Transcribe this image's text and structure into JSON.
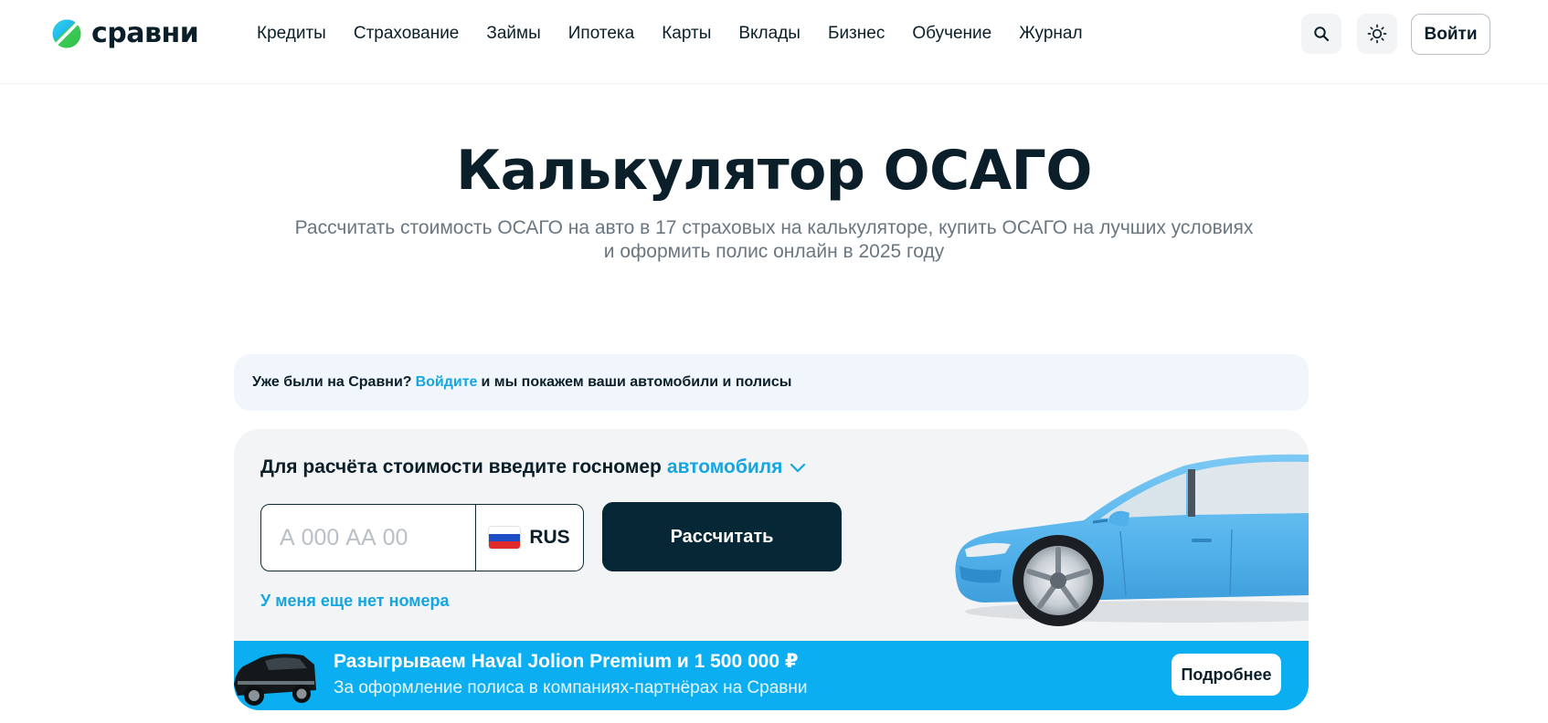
{
  "header": {
    "logo_text": "сравни",
    "nav": [
      "Кредиты",
      "Страхование",
      "Займы",
      "Ипотека",
      "Карты",
      "Вклады",
      "Бизнес",
      "Обучение",
      "Журнал"
    ],
    "login_label": "Войти",
    "search_icon": "search-icon",
    "theme_icon": "sun-icon"
  },
  "hero": {
    "title": "Калькулятор ОСАГО",
    "subtitle_line1": "Рассчитать стоимость ОСАГО на авто в 17 страховых на калькуляторе, купить ОСАГО на лучших условиях",
    "subtitle_line2": "и оформить полис онлайн в 2025 году"
  },
  "login_banner": {
    "prefix": "Уже были на Сравни?",
    "link": "Войдите",
    "suffix": "и мы покажем ваши автомобили и полисы"
  },
  "calculator": {
    "label": "Для расчёта стоимости введите госномер",
    "vehicle_type": "автомобиля",
    "plate_placeholder": "А 000 АА 00",
    "plate_value": "",
    "region": "RUS",
    "submit_label": "Рассчитать",
    "no_number_link": "У меня еще нет номера"
  },
  "promo": {
    "title": "Разыгрываем Haval Jolion Premium и  1 500 000 ₽",
    "subtitle": "За оформление полиса в компаниях-партнёрах на Сравни",
    "button_label": "Подробнее"
  },
  "colors": {
    "accent": "#14a6e0",
    "dark_button": "#062735",
    "promo_bg": "#0aaef1",
    "car_body": "#5bb8ef"
  }
}
